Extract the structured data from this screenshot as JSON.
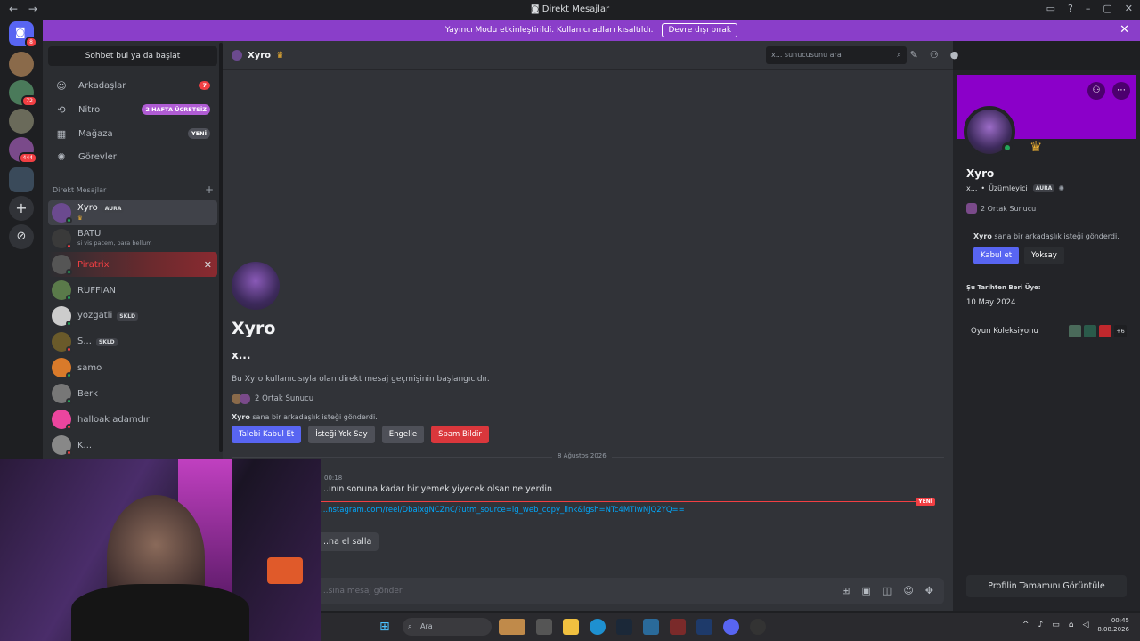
{
  "titlebar": {
    "title": "Direkt Mesajlar",
    "back": "←",
    "forward": "→"
  },
  "banner": {
    "text": "Yayıncı Modu etkinleştirildi. Kullanıcı adları kısaltıldı.",
    "disable": "Devre dışı bırak"
  },
  "servers": {
    "home_badge": "8",
    "badges": [
      "72",
      "444"
    ]
  },
  "sidebar": {
    "search": "Sohbet bul ya da başlat",
    "nav": [
      {
        "label": "Arkadaşlar",
        "icon": "friends-icon",
        "badge": "7"
      },
      {
        "label": "Nitro",
        "icon": "nitro-icon",
        "badge": "2 HAFTA ÜCRETSİZ"
      },
      {
        "label": "Mağaza",
        "icon": "shop-icon",
        "badge": "YENİ"
      },
      {
        "label": "Görevler",
        "icon": "quests-icon",
        "badge": ""
      }
    ],
    "dm_header": "Direkt Mesajlar",
    "dms": [
      {
        "name": "Xyro",
        "tag": "AURA",
        "sub": "",
        "color": "#6b4a8f",
        "status": "#23a55a"
      },
      {
        "name": "BATU",
        "tag": "",
        "sub": "si vis pacem, para bellum",
        "color": "#3a3a3a",
        "status": "#f23f43"
      },
      {
        "name": "Piratrix",
        "tag": "",
        "sub": "",
        "color": "#555",
        "status": "#23a55a"
      },
      {
        "name": "RUFFIAN",
        "tag": "",
        "sub": "",
        "color": "#5a7a4a",
        "status": "#23a55a"
      },
      {
        "name": "yozgatli",
        "tag": "SKLD",
        "sub": "",
        "color": "#ccc",
        "status": "#23a55a"
      },
      {
        "name": "S...",
        "tag": "SKLD",
        "sub": "",
        "color": "#6a5a2a",
        "status": "#f23f43"
      },
      {
        "name": "samo",
        "tag": "",
        "sub": "",
        "color": "#d97a2a",
        "status": "#23a55a"
      },
      {
        "name": "Berk",
        "tag": "",
        "sub": "",
        "color": "#777",
        "status": "#23a55a"
      },
      {
        "name": "halloak adamdır",
        "tag": "",
        "sub": "",
        "color": "#eb459e",
        "status": "#f23f43"
      },
      {
        "name": "K...",
        "tag": "",
        "sub": "",
        "color": "#888",
        "status": "#f23f43"
      }
    ]
  },
  "channel": {
    "name": "Xyro",
    "search_placeholder": "x... sunucusunu ara",
    "intro_name": "Xyro",
    "intro_sub": "x...",
    "intro_text": "Bu Xyro kullanıcısıyla olan direkt mesaj geçmişinin başlangıcıdır.",
    "mutual": "2 Ortak Sunucu",
    "request_name": "Xyro",
    "request_text": " sana bir arkadaşlık isteği gönderdi.",
    "buttons": {
      "accept": "Talebi Kabul Et",
      "ignore": "İsteği Yok Say",
      "block": "Engelle",
      "spam": "Spam Bildir"
    },
    "date": "8 Ağustos 2026",
    "time": "00:18",
    "message": "...ının sonuna kadar bir yemek yiyecek olsan ne yerdin",
    "new_label": "YENİ",
    "link": "...nstagram.com/reel/DbaixgNCZnC/?utm_source=ig_web_copy_link&igsh=NTc4MTIwNjQ2YQ==",
    "wave": "...na el salla",
    "composer_placeholder": "...sına mesaj gönder"
  },
  "profile": {
    "name": "Xyro",
    "handle": "x...",
    "pronoun": "Üzümleyici",
    "tag": "AURA",
    "mutual": "2 Ortak Sunucu",
    "request_name": "Xyro",
    "request_text": " sana bir arkadaşlık isteği gönderdi.",
    "accept": "Kabul et",
    "ignore": "Yoksay",
    "since_label": "Şu Tarihten Beri Üye:",
    "since": "10 May 2024",
    "games_label": "Oyun Koleksiyonu",
    "games_more": "+6",
    "full_profile": "Profilin Tamamını Görüntüle",
    "banner_color": "#8b00c9"
  },
  "taskbar": {
    "search": "Ara",
    "time": "00:45",
    "date": "8.08.2026"
  }
}
